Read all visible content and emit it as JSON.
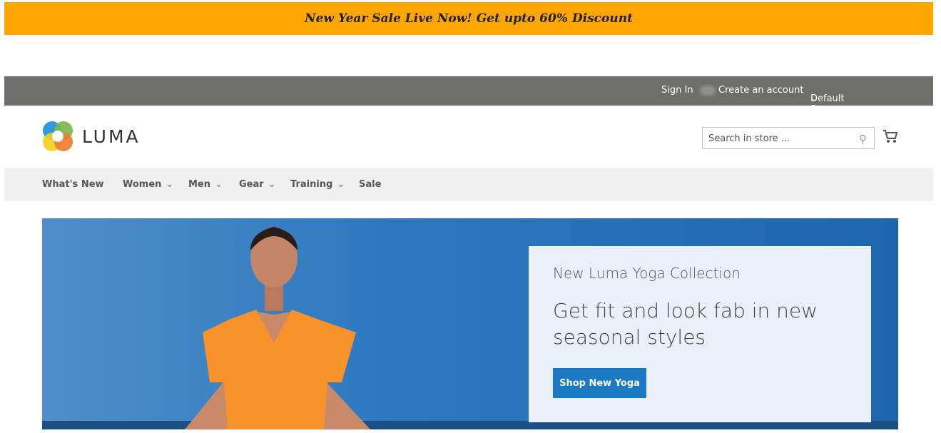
{
  "promo": {
    "text": "New Year Sale Live Now! Get upto 60% Discount",
    "color": "#ffa600"
  },
  "topbar": {
    "sign_in": "Sign In",
    "create_account": "Create an account",
    "store_view": "Default Store View"
  },
  "header": {
    "logo": "LUMA",
    "search_placeholder": "Search in store ...",
    "cart_icon": "cart-icon"
  },
  "nav": {
    "items": [
      {
        "label": "What's New",
        "dropdown": false
      },
      {
        "label": "Women",
        "dropdown": true
      },
      {
        "label": "Men",
        "dropdown": true
      },
      {
        "label": "Gear",
        "dropdown": true
      },
      {
        "label": "Training",
        "dropdown": true
      },
      {
        "label": "Sale",
        "dropdown": false
      }
    ]
  },
  "hero": {
    "subtitle": "New Luma Yoga Collection",
    "title": "Get fit and look fab in new seasonal styles",
    "button": "Shop New Yoga",
    "accent": "#1979c3"
  }
}
